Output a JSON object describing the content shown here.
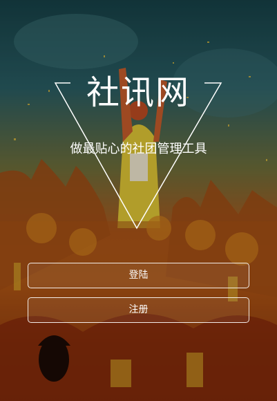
{
  "app": {
    "title": "社讯网",
    "slogan": "做最贴心的社团管理工具"
  },
  "actions": {
    "login_label": "登陆",
    "register_label": "注册"
  },
  "theme": {
    "text_color": "#ffffff",
    "button_border": "#ffffff"
  }
}
